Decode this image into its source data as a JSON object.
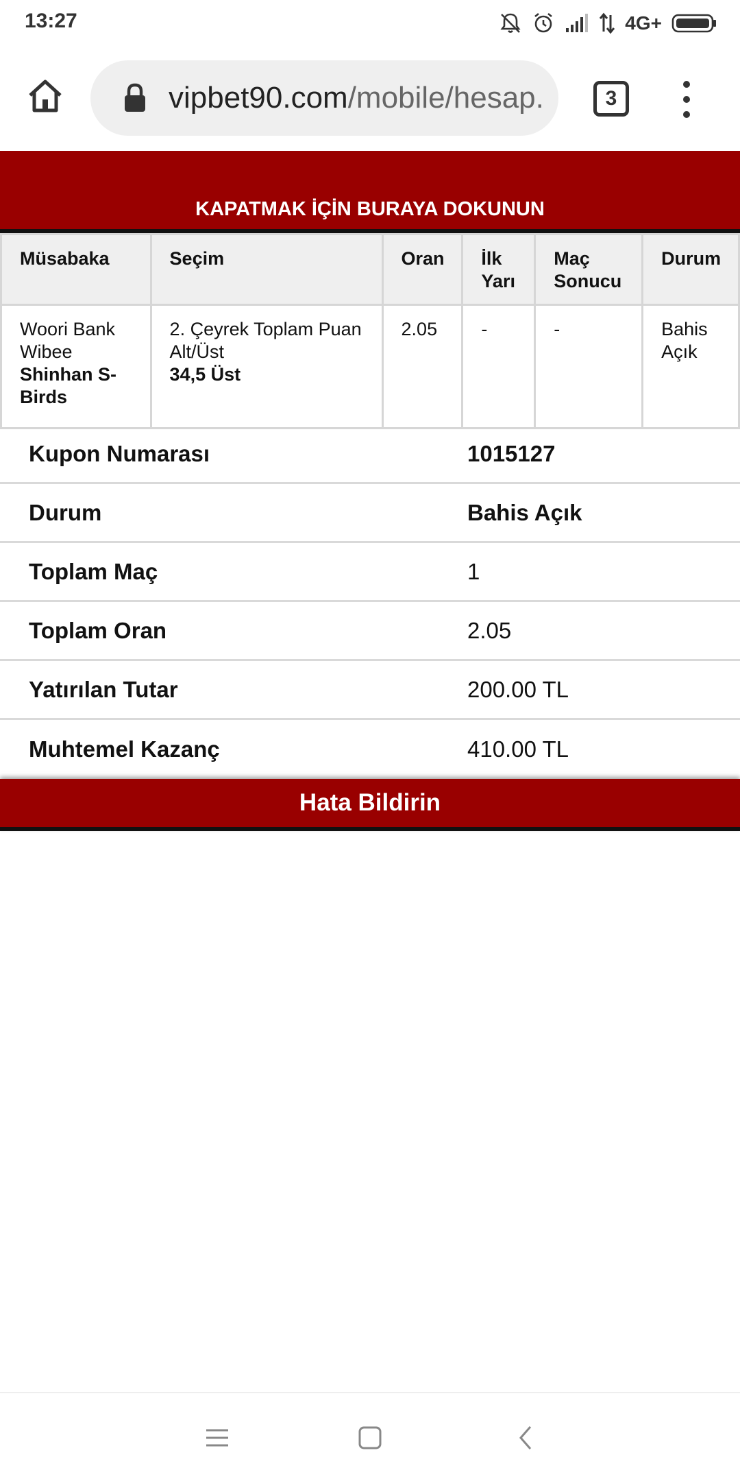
{
  "status_bar": {
    "time": "13:27",
    "network": "4G+",
    "icons": [
      "mute-icon",
      "alarm-icon",
      "signal-icon",
      "data-arrows-icon",
      "battery-icon"
    ]
  },
  "browser": {
    "url_domain": "vipbet90.com",
    "url_path": "/mobile/hesap.",
    "tab_count": "3",
    "icons": [
      "home-icon",
      "lock-icon",
      "tabs-icon",
      "more-menu-icon"
    ]
  },
  "banner": {
    "close_text": "KAPATMAK İÇİN BURAYA DOKUNUN"
  },
  "bets_table": {
    "headers": [
      "Müsabaka",
      "Seçim",
      "Oran",
      "İlk Yarı",
      "Maç Sonucu",
      "Durum"
    ],
    "rows": [
      {
        "home": "Woori Bank Wibee",
        "away": "Shinhan S-Birds",
        "market": "2. Çeyrek Toplam Puan Alt/Üst",
        "selection": "34,5 Üst",
        "odds": "2.05",
        "first_half": "-",
        "result": "-",
        "status": "Bahis Açık"
      }
    ]
  },
  "summary": [
    {
      "label": "Kupon Numarası",
      "value": "1015127",
      "bold": true
    },
    {
      "label": "Durum",
      "value": "Bahis Açık",
      "bold": true
    },
    {
      "label": "Toplam Maç",
      "value": "1",
      "bold": false
    },
    {
      "label": "Toplam Oran",
      "value": "2.05",
      "bold": false
    },
    {
      "label": "Yatırılan Tutar",
      "value": "200.00 TL",
      "bold": false
    },
    {
      "label": "Muhtemel Kazanç",
      "value": "410.00 TL",
      "bold": false
    }
  ],
  "report_button": "Hata Bildirin",
  "colors": {
    "brand_red": "#990000",
    "header_bg": "#efefef",
    "border": "#d6d6d6"
  }
}
